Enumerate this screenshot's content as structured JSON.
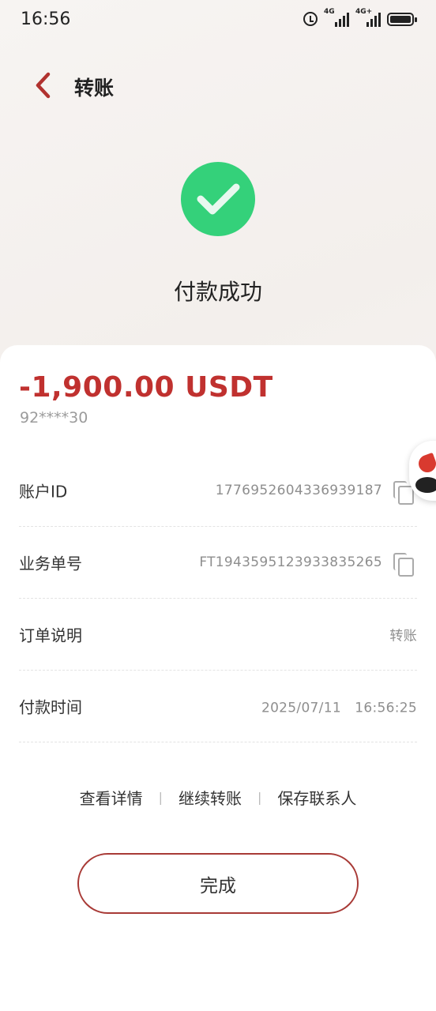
{
  "status_bar": {
    "time": "16:56",
    "network_1": "4G",
    "network_2": "4G+"
  },
  "header": {
    "title": "转账"
  },
  "result": {
    "status_text": "付款成功"
  },
  "summary": {
    "amount": "-1,900.00 USDT",
    "masked_account": "92****30"
  },
  "details": [
    {
      "label": "账户ID",
      "value": "1776952604336939187",
      "copyable": true
    },
    {
      "label": "业务单号",
      "value": "FT1943595123933835265",
      "copyable": true
    },
    {
      "label": "订单说明",
      "value": "转账",
      "copyable": false
    },
    {
      "label": "付款时间",
      "value": "2025/07/11　16:56:25",
      "copyable": false
    }
  ],
  "links": {
    "view_details": "查看详情",
    "continue_transfer": "继续转账",
    "save_contact": "保存联系人",
    "separator": "|"
  },
  "done_button": {
    "label": "完成"
  },
  "colors": {
    "accent": "#c0312f",
    "success": "#34d17a"
  }
}
